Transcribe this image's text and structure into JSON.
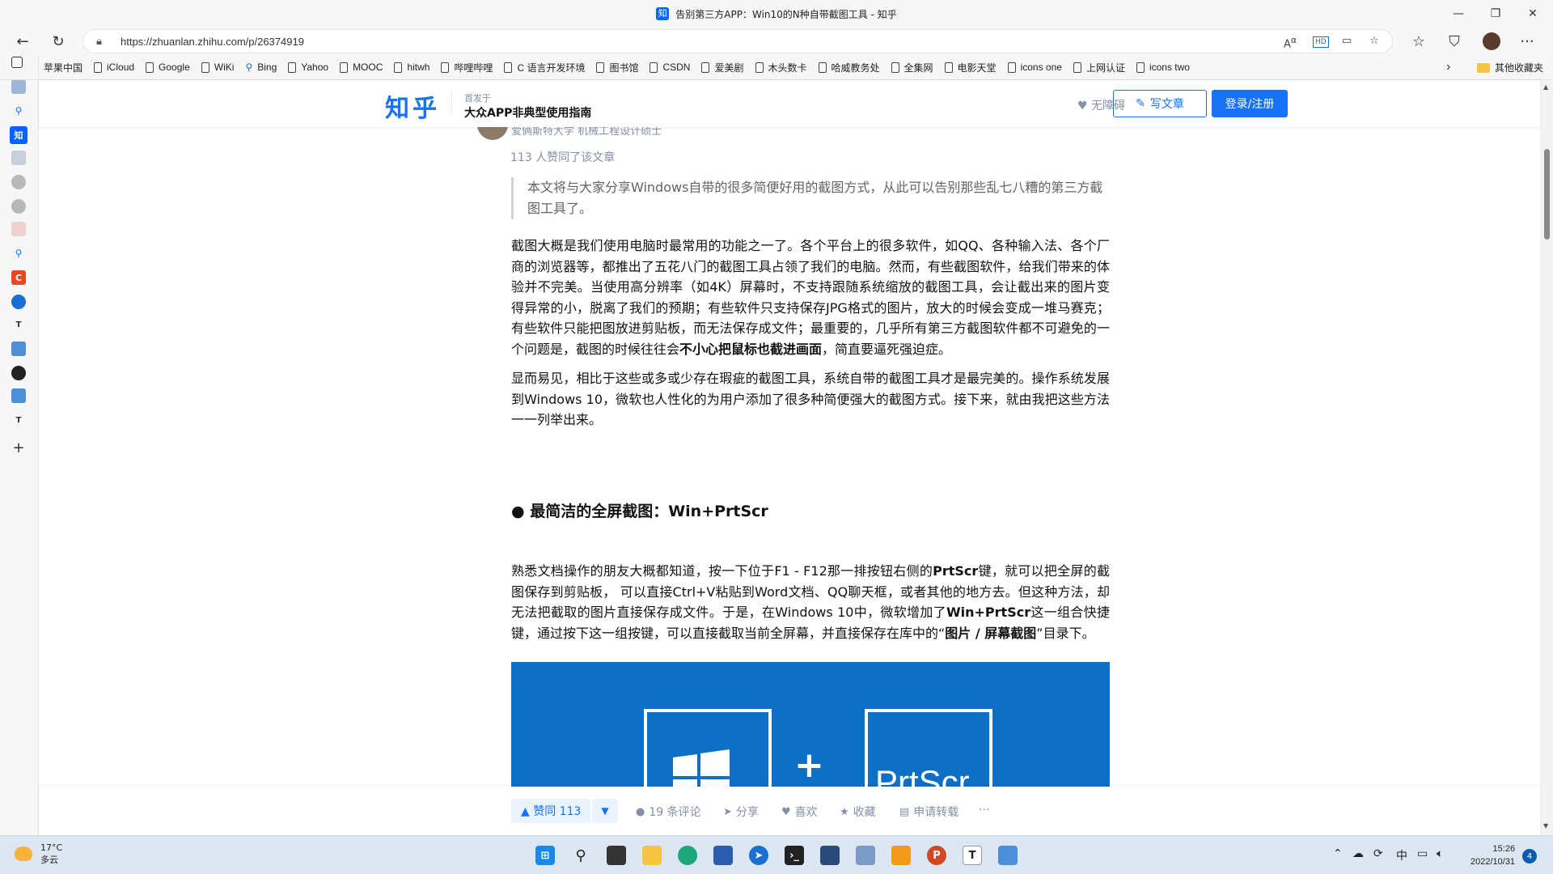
{
  "window": {
    "title": "告别第三方APP：Win10的N种自带截图工具 - 知乎",
    "tab_icon": "知"
  },
  "address_bar": {
    "url": "https://zhuanlan.zhihu.com/p/26374919"
  },
  "bookmarks": {
    "items": [
      {
        "label": "苹果中国",
        "icon": "apple-icon"
      },
      {
        "label": "iCloud",
        "icon": "page-icon"
      },
      {
        "label": "Google",
        "icon": "page-icon"
      },
      {
        "label": "WiKi",
        "icon": "page-icon"
      },
      {
        "label": "Bing",
        "icon": "search-icon"
      },
      {
        "label": "Yahoo",
        "icon": "page-icon"
      },
      {
        "label": "MOOC",
        "icon": "page-icon"
      },
      {
        "label": "hitwh",
        "icon": "page-icon"
      },
      {
        "label": "哔哩哔哩",
        "icon": "page-icon"
      },
      {
        "label": "C 语言开发环境",
        "icon": "page-icon"
      },
      {
        "label": "图书馆",
        "icon": "page-icon"
      },
      {
        "label": "CSDN",
        "icon": "page-icon"
      },
      {
        "label": "爱美剧",
        "icon": "page-icon"
      },
      {
        "label": "木头数卡",
        "icon": "page-icon"
      },
      {
        "label": "哈威教务处",
        "icon": "page-icon"
      },
      {
        "label": "全集网",
        "icon": "page-icon"
      },
      {
        "label": "电影天堂",
        "icon": "page-icon"
      },
      {
        "label": "icons one",
        "icon": "page-icon"
      },
      {
        "label": "上网认证",
        "icon": "page-icon"
      },
      {
        "label": "icons two",
        "icon": "page-icon"
      }
    ],
    "other_folder": "其他收藏夹"
  },
  "zhihu_header": {
    "logo": "知乎",
    "published_in_label": "首发于",
    "column_name": "大众APP非典型使用指南",
    "accessibility": "无障碍",
    "write_button": "写文章",
    "login_button": "登录/注册"
  },
  "article": {
    "author_peek": "爱俩斯特大学 机械工程设计硕士",
    "likes_line": "113 人赞同了该文章",
    "quote": "本文将与大家分享Windows自带的很多简便好用的截图方式，从此可以告别那些乱七八糟的第三方截图工具了。",
    "para1_a": "截图大概是我们使用电脑时最常用的功能之一了。各个平台上的很多软件，如QQ、各种输入法、各个厂商的浏览器等，都推出了五花八门的截图工具占领了我们的电脑。然而，有些截图软件，给我们带来的体验并不完美。当使用高分辨率（如4K）屏幕时，不支持跟随系统缩放的截图工具，会让截出来的图片变得异常的小，脱离了我们的预期；有些软件只支持保存JPG格式的图片，放大的时候会变成一堆马赛克；有些软件只能把图放进剪贴板，而无法保存成文件；最重要的，几乎所有第三方截图软件都不可避免的一个问题是，截图的时候往往会",
    "para1_bold": "不小心把鼠标也截进画面",
    "para1_b": "，简直要逼死强迫症。",
    "para2": "显而易见，相比于这些或多或少存在瑕疵的截图工具，系统自带的截图工具才是最完美的。操作系统发展到Windows 10，微软也人性化的为用户添加了很多种简便强大的截图方式。接下来，就由我把这些方法一一列举出来。",
    "heading": "● 最简洁的全屏截图：Win+PrtScr",
    "para3_a": "熟悉文档操作的朋友大概都知道，按一下位于F1 - F12那一排按钮右侧的",
    "para3_bold1": "PrtScr",
    "para3_b": "键，就可以把全屏的截图保存到剪贴板， 可以直接Ctrl+V粘贴到Word文档、QQ聊天框，或者其他的地方去。但这种方法，却无法把截取的图片直接保存成文件。于是，在Windows 10中，微软增加了",
    "para3_bold2": "Win+PrtScr",
    "para3_c": "这一组合快捷键，通过按下这一组按键，可以直接截取当前全屏幕，并直接保存在库中的“",
    "para3_bold3": "图片 / 屏幕截图",
    "para3_d": "”目录下。",
    "hero_plus": "+",
    "hero_key": "PrtScr"
  },
  "action_bar": {
    "upvote": "▲ 赞同 113",
    "downvote": "▼",
    "comments": "19 条评论",
    "share": "分享",
    "like": "喜欢",
    "favorite": "收藏",
    "repost": "申请转载",
    "more": "···"
  },
  "taskbar": {
    "temperature": "17°C",
    "weather": "多云",
    "ime": "中",
    "time": "15:26",
    "date": "2022/10/31",
    "notifications": "4"
  },
  "colors": {
    "zhihu_blue": "#1772f6",
    "hero_blue": "#0e6fc7",
    "muted_text": "#8590a6"
  }
}
